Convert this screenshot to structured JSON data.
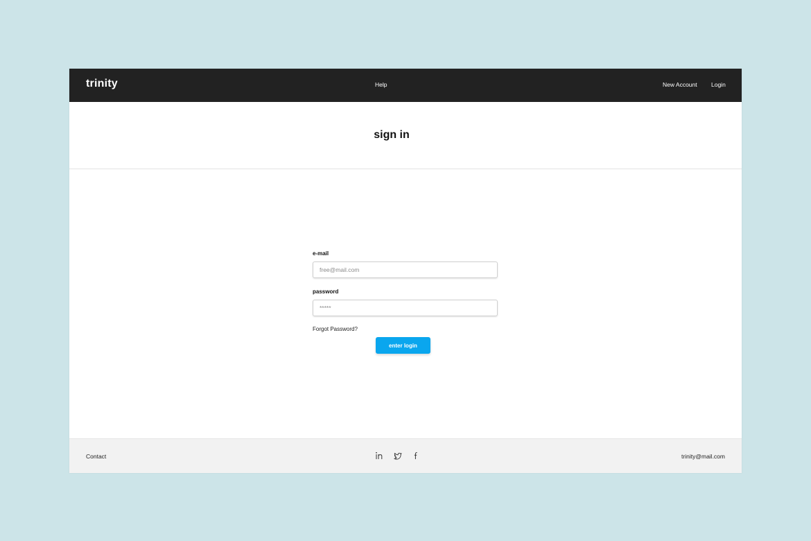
{
  "nav": {
    "brand": "trinity",
    "help": "Help",
    "new_account": "New Account",
    "login": "Login"
  },
  "page": {
    "title": "sign in"
  },
  "form": {
    "email_label": "e-mail",
    "email_placeholder": "free@mail.com",
    "password_label": "password",
    "password_placeholder": "*****",
    "forgot": "Forgot Password?",
    "submit": "enter login"
  },
  "footer": {
    "contact": "Contact",
    "email": "trinity@mail.com",
    "social": [
      "linkedin-icon",
      "twitter-icon",
      "facebook-icon"
    ]
  },
  "colors": {
    "background": "#cce4e8",
    "navbar": "#222222",
    "accent": "#0aa6ee",
    "footer": "#f2f2f2"
  }
}
